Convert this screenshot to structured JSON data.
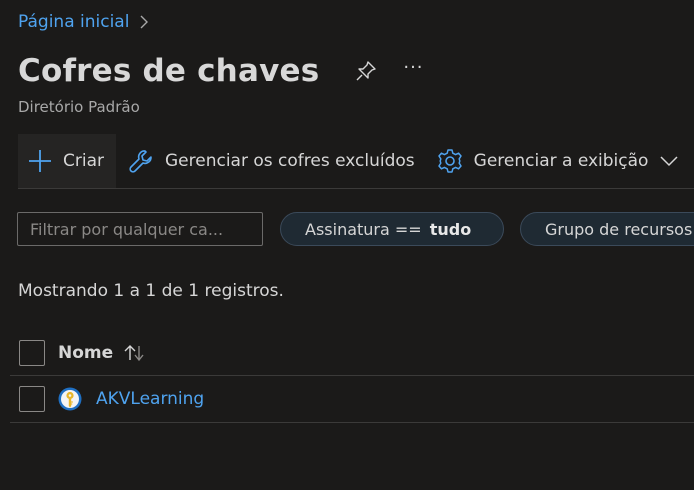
{
  "breadcrumb": {
    "home": "Página inicial"
  },
  "header": {
    "title": "Cofres de chaves",
    "more": "···",
    "subtitle": "Diretório Padrão"
  },
  "toolbar": {
    "create_label": "Criar",
    "manage_deleted_label": "Gerenciar os cofres excluídos",
    "manage_view_label": "Gerenciar a exibição"
  },
  "filters": {
    "search_placeholder": "Filtrar por qualquer ca...",
    "subscription_label": "Assinatura ==",
    "subscription_value": "tudo",
    "resource_group_label": "Grupo de recursos"
  },
  "records_text": "Mostrando 1 a 1 de 1 registros.",
  "table": {
    "columns": [
      "Nome"
    ],
    "rows": [
      {
        "name": "AKVLearning"
      }
    ]
  },
  "colors": {
    "accent": "#4fa3ef",
    "background": "#1b1a19",
    "pill_border": "#3b4a5a"
  },
  "icons": [
    "chevron-right-icon",
    "pin-icon",
    "plus-icon",
    "wrench-icon",
    "gear-icon",
    "chevron-down-icon",
    "sort-icon",
    "key-vault-icon"
  ]
}
